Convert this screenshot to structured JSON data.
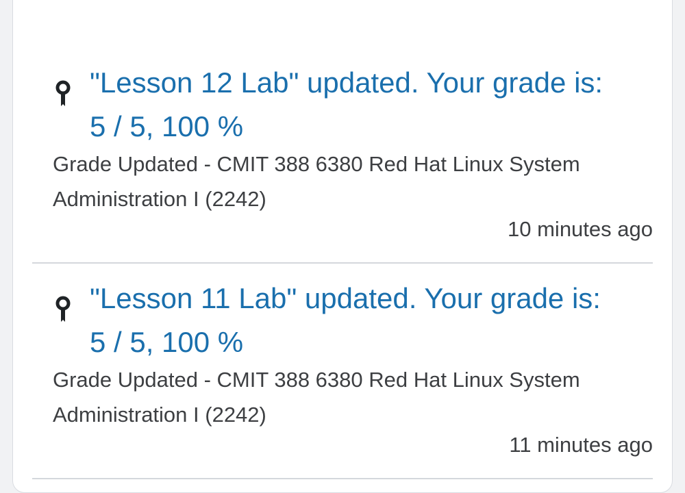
{
  "notifications": [
    {
      "icon": "award-ribbon-icon",
      "title_line1": "\"Lesson 12 Lab\" updated. Your grade is:",
      "title_line2": "5 / 5, 100 %",
      "description_line1": "Grade Updated - CMIT 388 6380 Red Hat Linux System",
      "description_line2": "Administration I (2242)",
      "time": "10 minutes ago"
    },
    {
      "icon": "award-ribbon-icon",
      "title_line1": "\"Lesson 11 Lab\" updated. Your grade is:",
      "title_line2": "5 / 5, 100 %",
      "description_line1": "Grade Updated - CMIT 388 6380 Red Hat Linux System",
      "description_line2": "Administration I (2242)",
      "time": "11 minutes ago"
    }
  ],
  "colors": {
    "link": "#1a6fad",
    "text": "#3d3f42",
    "divider": "#d4d7dc"
  }
}
